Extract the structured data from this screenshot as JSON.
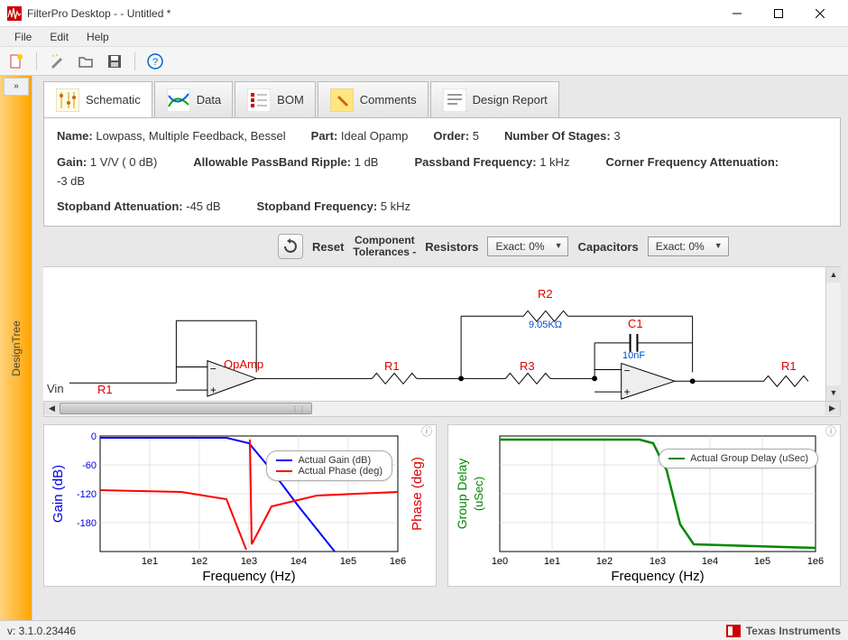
{
  "window": {
    "title": "FilterPro Desktop -  - Untitled *"
  },
  "menu": {
    "file": "File",
    "edit": "Edit",
    "help": "Help"
  },
  "sidebar": {
    "label": "DesignTree",
    "collapse": "»"
  },
  "tabs": {
    "schematic": "Schematic",
    "data": "Data",
    "bom": "BOM",
    "comments": "Comments",
    "report": "Design Report"
  },
  "info": {
    "name_label": "Name:",
    "name_value": "Lowpass, Multiple Feedback, Bessel",
    "part_label": "Part:",
    "part_value": "Ideal Opamp",
    "order_label": "Order:",
    "order_value": "5",
    "stages_label": "Number Of Stages:",
    "stages_value": "3",
    "gain_label": "Gain:",
    "gain_value": "1 V/V ( 0 dB)",
    "ripple_label": "Allowable PassBand Ripple:",
    "ripple_value": "1 dB",
    "passband_label": "Passband Frequency:",
    "passband_value": "1 kHz",
    "corner_label": "Corner Frequency Attenuation:",
    "corner_value": "-3 dB",
    "stopband_att_label": "Stopband Attenuation:",
    "stopband_att_value": "-45 dB",
    "stopband_freq_label": "Stopband Frequency:",
    "stopband_freq_value": "5 kHz"
  },
  "controls": {
    "reset": "Reset",
    "tolerances_line1": "Component",
    "tolerances_line2": "Tolerances -",
    "resistors_label": "Resistors",
    "resistors_value": "Exact: 0%",
    "capacitors_label": "Capacitors",
    "capacitors_value": "Exact: 0%"
  },
  "schematic": {
    "vin": "Vin",
    "r1_left": "R1",
    "opamp": "OpAmp",
    "r1_a": "R1",
    "r2": "R2",
    "r2_val": "9.05KΩ",
    "r3": "R3",
    "c1": "C1",
    "c1_val": "10nF",
    "r1_right": "R1"
  },
  "plot1": {
    "ylabel_left": "Gain (dB)",
    "ylabel_right": "Phase (deg)",
    "xlabel": "Frequency (Hz)",
    "legend_gain": "Actual Gain (dB)",
    "legend_phase": "Actual Phase (deg)"
  },
  "plot2": {
    "ylabel_left": "Group Delay (uSec)",
    "xlabel": "Frequency (Hz)",
    "legend": "Actual Group Delay (uSec)"
  },
  "status": {
    "version": "v: 3.1.0.23446",
    "brand": "Texas Instruments"
  },
  "chart_data": [
    {
      "type": "line",
      "title": "Gain / Phase vs Frequency",
      "xlabel": "Frequency (Hz)",
      "x_scale": "log",
      "x_ticks": [
        "1e1",
        "1e2",
        "1e3",
        "1e4",
        "1e5",
        "1e6"
      ],
      "ylabel_left": "Gain (dB)",
      "ylim_left": [
        -180,
        0
      ],
      "yticks_left": [
        0,
        -60,
        -120,
        -180
      ],
      "ylabel_right": "Phase (deg)",
      "ylim_right": [
        -200,
        200
      ],
      "series": [
        {
          "name": "Actual Gain (dB)",
          "color": "#0000ff",
          "x": [
            10,
            100,
            500,
            1000,
            2000,
            5000,
            10000,
            50000,
            100000,
            1000000
          ],
          "y": [
            0,
            0,
            -0.5,
            -3,
            -18,
            -45,
            -80,
            -140,
            -170,
            -200
          ]
        },
        {
          "name": "Actual Phase (deg)",
          "color": "#ff0000",
          "x": [
            10,
            100,
            500,
            900,
            1000,
            1100,
            2000,
            10000,
            100000,
            1000000
          ],
          "y": [
            -90,
            -92,
            -105,
            -170,
            170,
            -170,
            -110,
            -95,
            -92,
            -90
          ]
        }
      ]
    },
    {
      "type": "line",
      "title": "Group Delay vs Frequency",
      "xlabel": "Frequency (Hz)",
      "x_scale": "log",
      "x_ticks": [
        "1e0",
        "1e1",
        "1e2",
        "1e3",
        "1e4",
        "1e5",
        "1e6"
      ],
      "ylabel": "Group Delay (uSec)",
      "series": [
        {
          "name": "Actual Group Delay (uSec)",
          "color": "#008000",
          "x": [
            1,
            10,
            100,
            700,
            1000,
            1500,
            3000,
            10000,
            100000,
            1000000
          ],
          "y": [
            1.0,
            1.0,
            1.0,
            0.98,
            0.85,
            0.45,
            0.08,
            0.02,
            0.0,
            0.0
          ]
        }
      ]
    }
  ]
}
